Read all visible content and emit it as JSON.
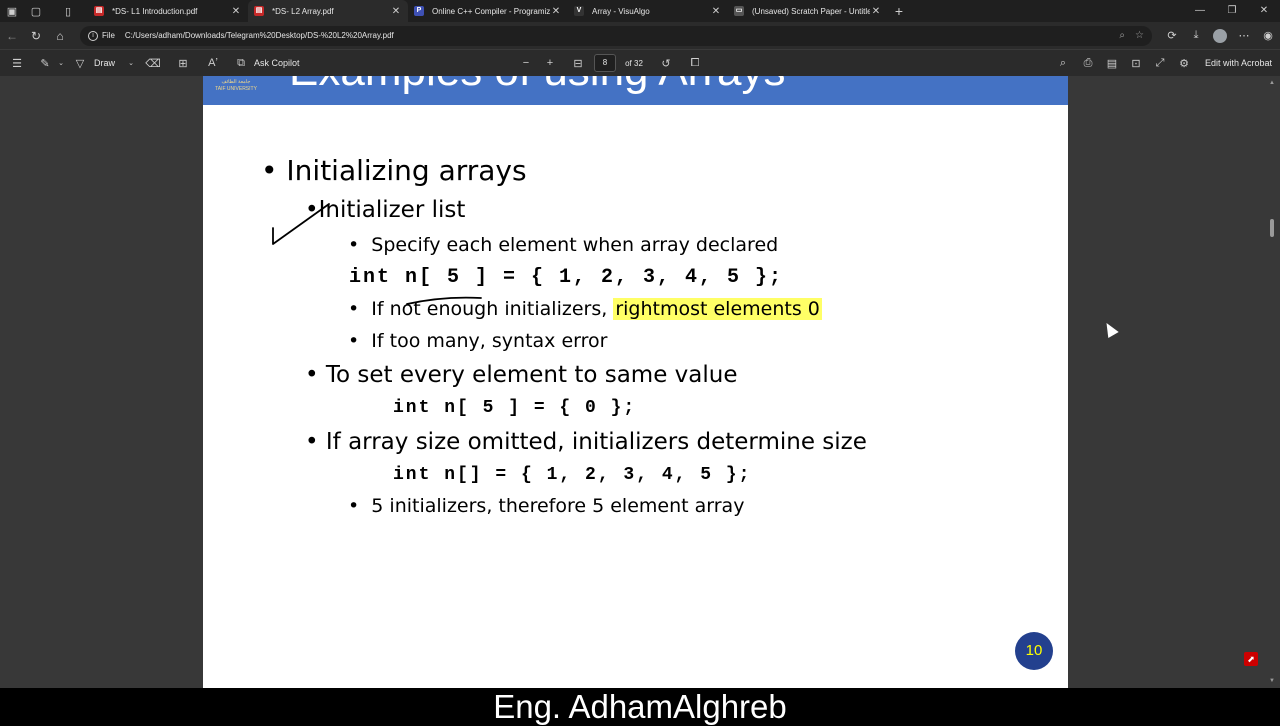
{
  "browser": {
    "tabs": [
      {
        "label": "*DS- L1 Introduction.pdf",
        "icon": "pdf-icon",
        "active": false
      },
      {
        "label": "*DS- L2 Array.pdf",
        "icon": "pdf-icon",
        "active": true
      },
      {
        "label": "Online C++ Compiler - Programiz",
        "icon": "programiz-icon",
        "active": false
      },
      {
        "label": "Array - VisuAlgo",
        "icon": "visualgo-icon",
        "active": false
      },
      {
        "label": "(Unsaved) Scratch Paper - Untitled",
        "icon": "scratch-icon",
        "active": false
      }
    ],
    "url_scheme": "File",
    "url": "C:/Users/adham/Downloads/Telegram%20Desktop/DS-%20L2%20Array.pdf"
  },
  "pdf_toolbar": {
    "draw_label": "Draw",
    "ask_copilot": "Ask Copilot",
    "page_current": "8",
    "page_total": "of 32",
    "edit_with_acrobat": "Edit with Acrobat"
  },
  "slide": {
    "header_title": "Examples of using Arrays",
    "logo_text_ar": "جامعة الطائف",
    "logo_text_en": "TAIF UNIVERSITY",
    "lines": {
      "l1": "Initializing arrays",
      "l2": "Initializer list",
      "l3": "Specify each element when array declared",
      "code1": "int n[ 5 ] = { 1, 2, 3, 4, 5 };",
      "l4a": "If not enough initializers, ",
      "l4b": "rightmost elements 0",
      "l5": "If too many, syntax error",
      "l6": "To set every element to same value",
      "code2": "int n[ 5 ] = { 0 };",
      "l7": "If array size omitted, initializers determine size",
      "code3": "int n[] = { 1, 2, 3, 4, 5 };",
      "l8": "5 initializers, therefore 5 element array"
    },
    "page_number": "10"
  },
  "caption": "Eng. AdhamAlghreb",
  "colors": {
    "header_blue": "#4472c4",
    "highlight": "#ffff66",
    "page_badge": "#23408e"
  }
}
